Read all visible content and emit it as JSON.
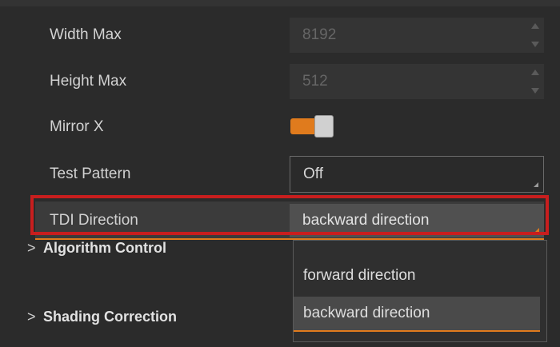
{
  "rows": [
    {
      "label": "Width Max",
      "value": "8192"
    },
    {
      "label": "Height Max",
      "value": "512"
    },
    {
      "label": "Mirror X"
    },
    {
      "label": "Test Pattern",
      "value": "Off"
    },
    {
      "label": "TDI Direction",
      "value": "backward direction"
    }
  ],
  "mirror_x": {
    "on": true
  },
  "sections": [
    {
      "label": "Algorithm Control"
    },
    {
      "label": "Shading Correction"
    }
  ],
  "tdi_dropdown": {
    "options": [
      "forward direction",
      "backward direction"
    ],
    "selected": "backward direction"
  },
  "colors": {
    "accent": "#e07b1d",
    "highlight": "#c81e1e",
    "background": "#2b2b2b"
  }
}
